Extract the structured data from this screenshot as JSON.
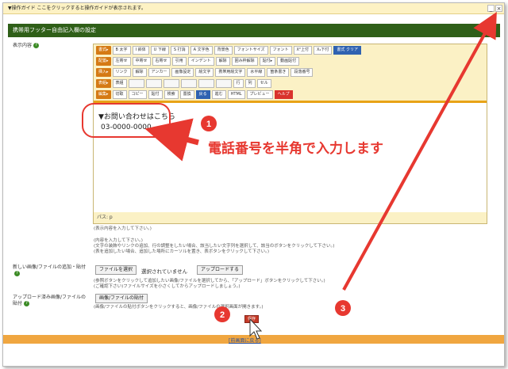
{
  "notice": "▼操作ガイド ここをクリックすると操作ガイドが表示されます。",
  "close_label": "×",
  "header_title": "携帯用フッター自由記入欄の設定",
  "labels": {
    "display": "表示内容",
    "add_file": "新しい画像/ファイルの追加・貼付",
    "uploaded": "アップロード済み画像/ファイルの貼付"
  },
  "toolbar": [
    {
      "tag": "書式▸",
      "items": [
        "B 太字",
        "I 斜体",
        "U 下線",
        "S 打消",
        "A 文字色",
        "背景色",
        "フォントサイズ",
        "フォント",
        "X²上付",
        "X₂下付",
        "書式 クリア"
      ]
    },
    {
      "tag": "配置▸",
      "items": [
        "左寄せ",
        "中寄せ",
        "右寄せ",
        "引用",
        "インデント",
        "解除",
        "囲み枠解除",
        "貼付▸",
        "動画貼付"
      ]
    },
    {
      "tag": "挿入▸",
      "items": [
        "リンク",
        "解除",
        "アンカー",
        "画像設定",
        "絵文字",
        "携帯用絵文字",
        "水平線",
        "箇条書き",
        "段落番号"
      ]
    },
    {
      "tag": "表組▸",
      "items": [
        "表組",
        "",
        "",
        "",
        "",
        "",
        "",
        "行",
        "列",
        "セル"
      ]
    },
    {
      "tag": "編集▸",
      "items": [
        "切取",
        "コピー",
        "貼付",
        "検索",
        "置換",
        "戻る",
        "進む",
        "HTML",
        "プレビュー",
        "ヘルプ"
      ]
    }
  ],
  "editor": {
    "line1": "▼お問い合わせはこちら",
    "line2": "03-0000-0000",
    "path": "パス: p"
  },
  "help_display": [
    "(表示内容を入力して下さい。)",
    "(内容を入力して下さい。)",
    "(文字の装飾やリンクの追加、行の調整をしたい場合、該当したい文字列を選択して、該当のボタンをクリックして下さい。)",
    "(表を追加したい場合、追加した場所にカーソルを置き、表ボタンをクリックして下さい。)"
  ],
  "file_button": "ファイルを選択",
  "file_status": "選択されていません",
  "upload_button": "アップロードする",
  "help_file": [
    "(参照ボタンをクリックして追加したい画像/ファイルを選択してから、「アップロード」ボタンをクリックして下さい。)",
    "(ご確認下さい)ファイルサイズを小さくしてからアップロードしましょう。)"
  ],
  "paste_button": "画像/ファイルの貼付",
  "help_paste": "(画像/ファイルの貼付ボタンをクリックすると、画像/ファイルの選択画面が開きます。)",
  "save_button": "保存",
  "back_link": "[前画面に戻る]",
  "annotation_text": "電話番号を半角で入力します",
  "markers": [
    "1",
    "2",
    "3"
  ],
  "colors": {
    "annotation": "#e73830",
    "header": "#2f5f18",
    "toolbar": "#fbf1c5"
  }
}
